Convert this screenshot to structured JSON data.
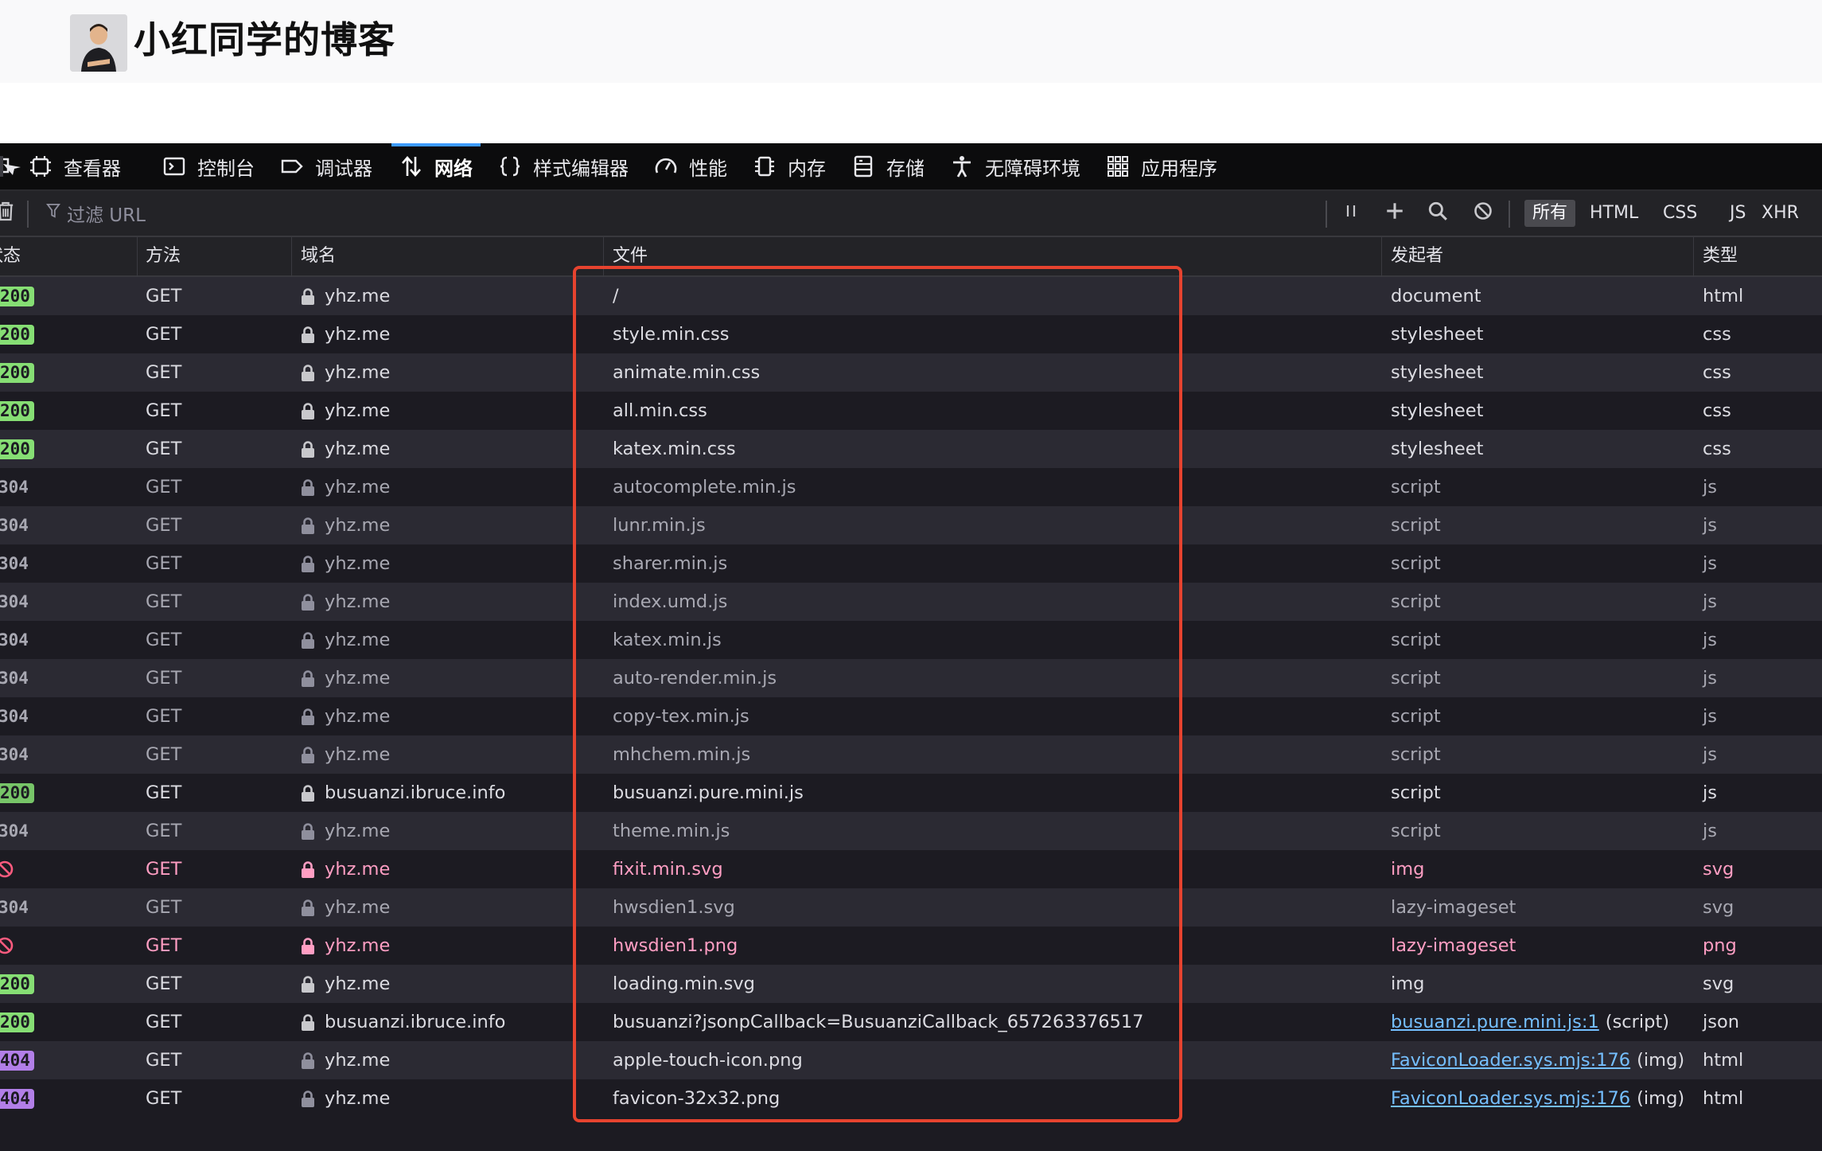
{
  "blog": {
    "title": "小红同学的博客"
  },
  "devtools": {
    "tabs": [
      {
        "label": "查看器",
        "icon": "inspector-icon"
      },
      {
        "label": "控制台",
        "icon": "console-icon"
      },
      {
        "label": "调试器",
        "icon": "debugger-icon"
      },
      {
        "label": "网络",
        "icon": "network-icon",
        "selected": true
      },
      {
        "label": "样式编辑器",
        "icon": "style-editor-icon"
      },
      {
        "label": "性能",
        "icon": "performance-icon"
      },
      {
        "label": "内存",
        "icon": "memory-icon"
      },
      {
        "label": "存储",
        "icon": "storage-icon"
      },
      {
        "label": "无障碍环境",
        "icon": "accessibility-icon"
      },
      {
        "label": "应用程序",
        "icon": "application-icon"
      }
    ],
    "toolbar": {
      "filter_placeholder": "过滤 URL",
      "type_filters": [
        "所有",
        "HTML",
        "CSS",
        "JS",
        "XHR"
      ],
      "active_type_filter": "所有"
    },
    "columns": [
      "状态",
      "方法",
      "域名",
      "文件",
      "发起者",
      "类型"
    ],
    "requests": [
      {
        "status": "200",
        "method": "GET",
        "domain": "yhz.me",
        "file": "/",
        "initiator": "document",
        "type": "html",
        "kind": "ok"
      },
      {
        "status": "200",
        "method": "GET",
        "domain": "yhz.me",
        "file": "style.min.css",
        "initiator": "stylesheet",
        "type": "css",
        "kind": "ok"
      },
      {
        "status": "200",
        "method": "GET",
        "domain": "yhz.me",
        "file": "animate.min.css",
        "initiator": "stylesheet",
        "type": "css",
        "kind": "ok"
      },
      {
        "status": "200",
        "method": "GET",
        "domain": "yhz.me",
        "file": "all.min.css",
        "initiator": "stylesheet",
        "type": "css",
        "kind": "ok"
      },
      {
        "status": "200",
        "method": "GET",
        "domain": "yhz.me",
        "file": "katex.min.css",
        "initiator": "stylesheet",
        "type": "css",
        "kind": "ok"
      },
      {
        "status": "304",
        "method": "GET",
        "domain": "yhz.me",
        "file": "autocomplete.min.js",
        "initiator": "script",
        "type": "js",
        "kind": "cached"
      },
      {
        "status": "304",
        "method": "GET",
        "domain": "yhz.me",
        "file": "lunr.min.js",
        "initiator": "script",
        "type": "js",
        "kind": "cached"
      },
      {
        "status": "304",
        "method": "GET",
        "domain": "yhz.me",
        "file": "sharer.min.js",
        "initiator": "script",
        "type": "js",
        "kind": "cached"
      },
      {
        "status": "304",
        "method": "GET",
        "domain": "yhz.me",
        "file": "index.umd.js",
        "initiator": "script",
        "type": "js",
        "kind": "cached"
      },
      {
        "status": "304",
        "method": "GET",
        "domain": "yhz.me",
        "file": "katex.min.js",
        "initiator": "script",
        "type": "js",
        "kind": "cached"
      },
      {
        "status": "304",
        "method": "GET",
        "domain": "yhz.me",
        "file": "auto-render.min.js",
        "initiator": "script",
        "type": "js",
        "kind": "cached"
      },
      {
        "status": "304",
        "method": "GET",
        "domain": "yhz.me",
        "file": "copy-tex.min.js",
        "initiator": "script",
        "type": "js",
        "kind": "cached"
      },
      {
        "status": "304",
        "method": "GET",
        "domain": "yhz.me",
        "file": "mhchem.min.js",
        "initiator": "script",
        "type": "js",
        "kind": "cached"
      },
      {
        "status": "200",
        "method": "GET",
        "domain": "busuanzi.ibruce.info",
        "file": "busuanzi.pure.mini.js",
        "initiator": "script",
        "type": "js",
        "kind": "ok-cache"
      },
      {
        "status": "304",
        "method": "GET",
        "domain": "yhz.me",
        "file": "theme.min.js",
        "initiator": "script",
        "type": "js",
        "kind": "cached"
      },
      {
        "status": "",
        "method": "GET",
        "domain": "yhz.me",
        "file": "fixit.min.svg",
        "initiator": "img",
        "type": "svg",
        "kind": "blocked"
      },
      {
        "status": "304",
        "method": "GET",
        "domain": "yhz.me",
        "file": "hwsdien1.svg",
        "initiator": "lazy-imageset",
        "type": "svg",
        "kind": "cached"
      },
      {
        "status": "",
        "method": "GET",
        "domain": "yhz.me",
        "file": "hwsdien1.png",
        "initiator": "lazy-imageset",
        "type": "png",
        "kind": "blocked"
      },
      {
        "status": "200",
        "method": "GET",
        "domain": "yhz.me",
        "file": "loading.min.svg",
        "initiator": "img",
        "type": "svg",
        "kind": "ok"
      },
      {
        "status": "200",
        "method": "GET",
        "domain": "busuanzi.ibruce.info",
        "file": "busuanzi?jsonpCallback=BusuanziCallback_657263376517",
        "initiator": "busuanzi.pure.mini.js:1",
        "initiator_suffix": "(script)",
        "type": "json",
        "kind": "ok"
      },
      {
        "status": "404",
        "method": "GET",
        "domain": "yhz.me",
        "file": "apple-touch-icon.png",
        "initiator": "FaviconLoader.sys.mjs:176",
        "initiator_suffix": "(img)",
        "type": "html",
        "kind": "purple"
      },
      {
        "status": "404",
        "method": "GET",
        "domain": "yhz.me",
        "file": "favicon-32x32.png",
        "initiator": "FaviconLoader.sys.mjs:176",
        "initiator_suffix": "(img)",
        "type": "html",
        "kind": "purple"
      }
    ]
  },
  "colors": {
    "accent": "#3d9bff",
    "ok": "#86de74",
    "notfound": "#b27fe8",
    "blocked": "#ff9ec3",
    "highlight": "#e6432f"
  }
}
